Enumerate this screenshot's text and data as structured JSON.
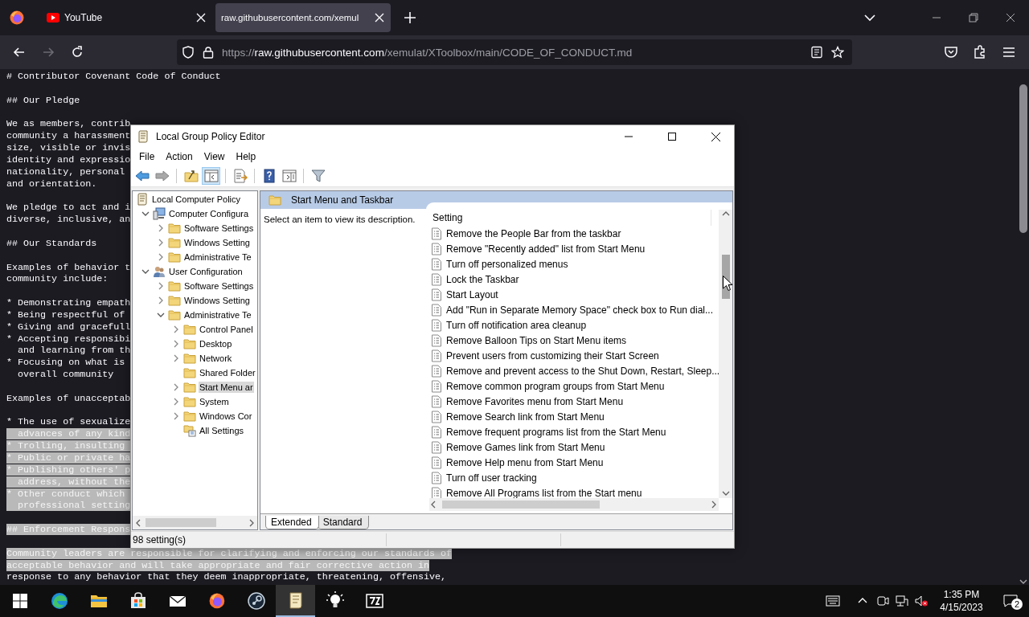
{
  "browser": {
    "tabs": [
      {
        "title": "YouTube",
        "kind": "youtube",
        "selected": false
      },
      {
        "title": "raw.githubusercontent.com/xemul",
        "kind": "plain",
        "selected": true
      }
    ],
    "nav_buttons": [
      {
        "kind": "back",
        "disabled": false
      },
      {
        "kind": "forward",
        "disabled": true
      },
      {
        "kind": "reload",
        "disabled": false
      }
    ],
    "url": {
      "scheme": "https://",
      "host": "raw.githubusercontent.com",
      "path": "/xemulat/XToolbox/main/CODE_OF_CONDUCT.md"
    }
  },
  "document": {
    "paragraphs": [
      {
        "lines": [
          {
            "text": "# Contributor Covenant Code of Conduct",
            "selected": false
          }
        ]
      },
      {
        "lines": [
          {
            "text": "## Our Pledge",
            "selected": false
          }
        ]
      },
      {
        "lines": [
          {
            "text": "We as members, contrib",
            "selected": false
          },
          {
            "text": "community a harassment",
            "selected": false
          },
          {
            "text": "size, visible or invis",
            "selected": false
          },
          {
            "text": "identity and expressio",
            "selected": false
          },
          {
            "text": "nationality, personal",
            "selected": false
          },
          {
            "text": "and orientation.",
            "selected": false
          }
        ]
      },
      {
        "lines": [
          {
            "text": "We pledge to act and i",
            "selected": false
          },
          {
            "text": "diverse, inclusive, an",
            "selected": false
          }
        ]
      },
      {
        "lines": [
          {
            "text": "## Our Standards",
            "selected": false
          }
        ]
      },
      {
        "lines": [
          {
            "text": "Examples of behavior t",
            "selected": false
          },
          {
            "text": "community include:",
            "selected": false
          }
        ]
      },
      {
        "lines": [
          {
            "text": "* Demonstrating empath",
            "selected": false
          },
          {
            "text": "* Being respectful of",
            "selected": false
          },
          {
            "text": "* Giving and gracefull",
            "selected": false
          },
          {
            "text": "* Accepting responsibi",
            "selected": false
          },
          {
            "text": "  and learning from th",
            "selected": false
          },
          {
            "text": "* Focusing on what is",
            "selected": false
          },
          {
            "text": "  overall community",
            "selected": false
          }
        ]
      },
      {
        "lines": [
          {
            "text": "Examples of unacceptab",
            "selected": false
          }
        ]
      },
      {
        "lines": [
          {
            "text": "* The use of sexualize",
            "selected": false
          },
          {
            "text": "  advances of any kind",
            "selected": true
          },
          {
            "text": "* Trolling, insulting ",
            "selected": true
          },
          {
            "text": "* Public or private ha",
            "selected": true
          },
          {
            "text": "* Publishing others' p",
            "selected": true
          },
          {
            "text": "  address, without the",
            "selected": true
          },
          {
            "text": "* Other conduct which ",
            "selected": true
          },
          {
            "text": "  professional setting",
            "selected": true
          }
        ]
      },
      {
        "lines": [
          {
            "text": "## Enforcement Respons",
            "selected": true
          }
        ]
      },
      {
        "lines": [
          {
            "text": "Community leaders are responsible for clarifying and enforcing our standards of",
            "selected": true
          },
          {
            "text": "acceptable behavior and will take appropriate and fair corrective action in",
            "selected": true
          },
          {
            "text": "response to any behavior that they deem inappropriate, threatening, offensive,",
            "selected": false
          }
        ]
      }
    ]
  },
  "dialog": {
    "title": "Local Group Policy Editor",
    "menu": [
      "File",
      "Action",
      "View",
      "Help"
    ],
    "toolbar": [
      {
        "kind": "back",
        "pressed": false,
        "disabled": false
      },
      {
        "kind": "forward",
        "pressed": false,
        "disabled": true
      },
      {
        "kind": "up",
        "pressed": false,
        "disabled": false
      },
      {
        "kind": "tree",
        "pressed": true,
        "disabled": false
      },
      {
        "kind": "export",
        "pressed": false,
        "disabled": false
      },
      {
        "kind": "help",
        "pressed": false,
        "disabled": false
      },
      {
        "kind": "view",
        "pressed": false,
        "disabled": false
      },
      {
        "kind": "filter",
        "pressed": false,
        "disabled": false
      }
    ],
    "tree": [
      {
        "label": "Local Computer Policy",
        "kind": "policy",
        "selected": false,
        "children": [
          {
            "label": "Computer Configura",
            "kind": "computer",
            "expanded": true,
            "selected": false,
            "children": [
              {
                "label": "Software Settings",
                "kind": "folder",
                "expanded": false,
                "selected": false
              },
              {
                "label": "Windows Setting",
                "kind": "folder",
                "expanded": false,
                "selected": false
              },
              {
                "label": "Administrative Te",
                "kind": "folder",
                "expanded": false,
                "selected": false
              }
            ]
          },
          {
            "label": "User Configuration",
            "kind": "user",
            "expanded": true,
            "selected": false,
            "children": [
              {
                "label": "Software Settings",
                "kind": "folder",
                "expanded": false,
                "selected": false
              },
              {
                "label": "Windows Setting",
                "kind": "folder",
                "expanded": false,
                "selected": false
              },
              {
                "label": "Administrative Te",
                "kind": "folder",
                "expanded": true,
                "selected": false,
                "children": [
                  {
                    "label": "Control Panel",
                    "kind": "folder",
                    "expanded": false,
                    "selected": false
                  },
                  {
                    "label": "Desktop",
                    "kind": "folder",
                    "expanded": false,
                    "selected": false
                  },
                  {
                    "label": "Network",
                    "kind": "folder",
                    "expanded": false,
                    "selected": false
                  },
                  {
                    "label": "Shared Folder",
                    "kind": "folder",
                    "selected": false
                  },
                  {
                    "label": "Start Menu ar",
                    "kind": "folder",
                    "expanded": false,
                    "selected": true
                  },
                  {
                    "label": "System",
                    "kind": "folder",
                    "expanded": false,
                    "selected": false
                  },
                  {
                    "label": "Windows Cor",
                    "kind": "folder",
                    "expanded": false,
                    "selected": false
                  },
                  {
                    "label": "All Settings",
                    "kind": "settings",
                    "selected": false
                  }
                ]
              }
            ]
          }
        ]
      }
    ],
    "panel_title": "Start Menu and Taskbar",
    "description": "Select an item to view its description.",
    "column": "Setting",
    "settings": [
      "Remove the People Bar from the taskbar",
      "Remove \"Recently added\" list from Start Menu",
      "Turn off personalized menus",
      "Lock the Taskbar",
      "Start Layout",
      "Add \"Run in Separate Memory Space\" check box to Run dial...",
      "Turn off notification area cleanup",
      "Remove Balloon Tips on Start Menu items",
      "Prevent users from customizing their Start Screen",
      "Remove and prevent access to the Shut Down, Restart, Sleep...",
      "Remove common program groups from Start Menu",
      "Remove Favorites menu from Start Menu",
      "Remove Search link from Start Menu",
      "Remove frequent programs list from the Start Menu",
      "Remove Games link from Start Menu",
      "Remove Help menu from Start Menu",
      "Turn off user tracking",
      "Remove All Programs list from the Start menu"
    ],
    "tabs": [
      {
        "label": "Extended",
        "selected": true
      },
      {
        "label": "Standard",
        "selected": false
      }
    ],
    "status": "98 setting(s)"
  },
  "taskbar": {
    "apps": [
      {
        "kind": "edge",
        "active": false
      },
      {
        "kind": "explorer",
        "active": false
      },
      {
        "kind": "store",
        "active": false
      },
      {
        "kind": "mail",
        "active": false
      },
      {
        "kind": "firefox",
        "active": false
      },
      {
        "kind": "steam",
        "active": false
      },
      {
        "kind": "notepad",
        "active": true
      },
      {
        "kind": "bulb",
        "active": false
      },
      {
        "kind": "archive",
        "active": false
      }
    ],
    "time": "1:35 PM",
    "date": "4/15/2023",
    "notifications": "2"
  }
}
